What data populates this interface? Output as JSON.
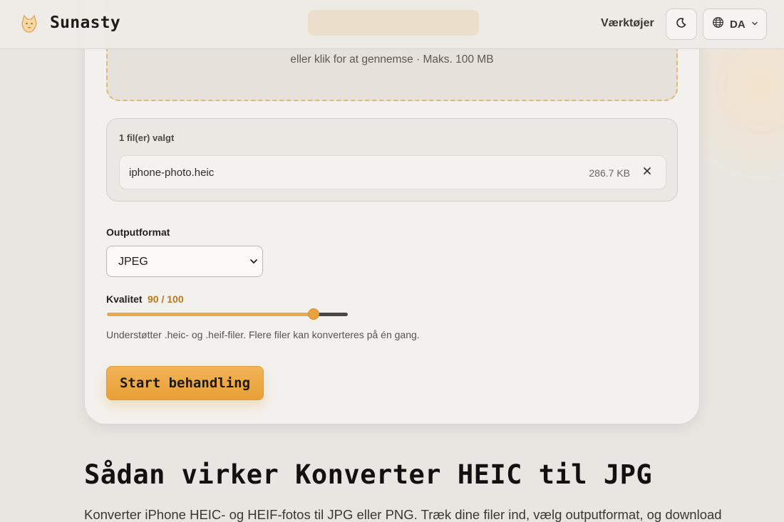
{
  "header": {
    "brand": "Sunasty",
    "nav_tools": "Værktøjer",
    "lang": "DA",
    "icons": {
      "logo": "cat-logo-icon",
      "theme": "moon-icon",
      "lang": "globe-icon",
      "lang_chevron": "chevron-down-icon"
    }
  },
  "dropzone": {
    "subtitle": "eller klik for at gennemse · Maks. 100 MB"
  },
  "files": {
    "count_label": "1 fil(er) valgt",
    "items": [
      {
        "name": "iphone-photo.heic",
        "size": "286.7 KB",
        "remove_icon": "close-icon"
      }
    ]
  },
  "output": {
    "label": "Outputformat",
    "selected": "JPEG"
  },
  "quality": {
    "label": "Kvalitet",
    "value_text": "90 / 100",
    "value": 90,
    "max": 100
  },
  "hint": "Understøtter .heic- og .heif-filer. Flere filer kan konverteres på én gang.",
  "start_button": "Start behandling",
  "section": {
    "title": "Sådan virker Konverter HEIC til JPG",
    "body": "Konverter iPhone HEIC- og HEIF-fotos til JPG eller PNG. Træk dine filer ind, vælg outputformat, og download"
  },
  "colors": {
    "accent": "#e89f35",
    "accent_text": "#b8781f",
    "background": "#e9e6e1",
    "card": "#f3f1ed"
  }
}
